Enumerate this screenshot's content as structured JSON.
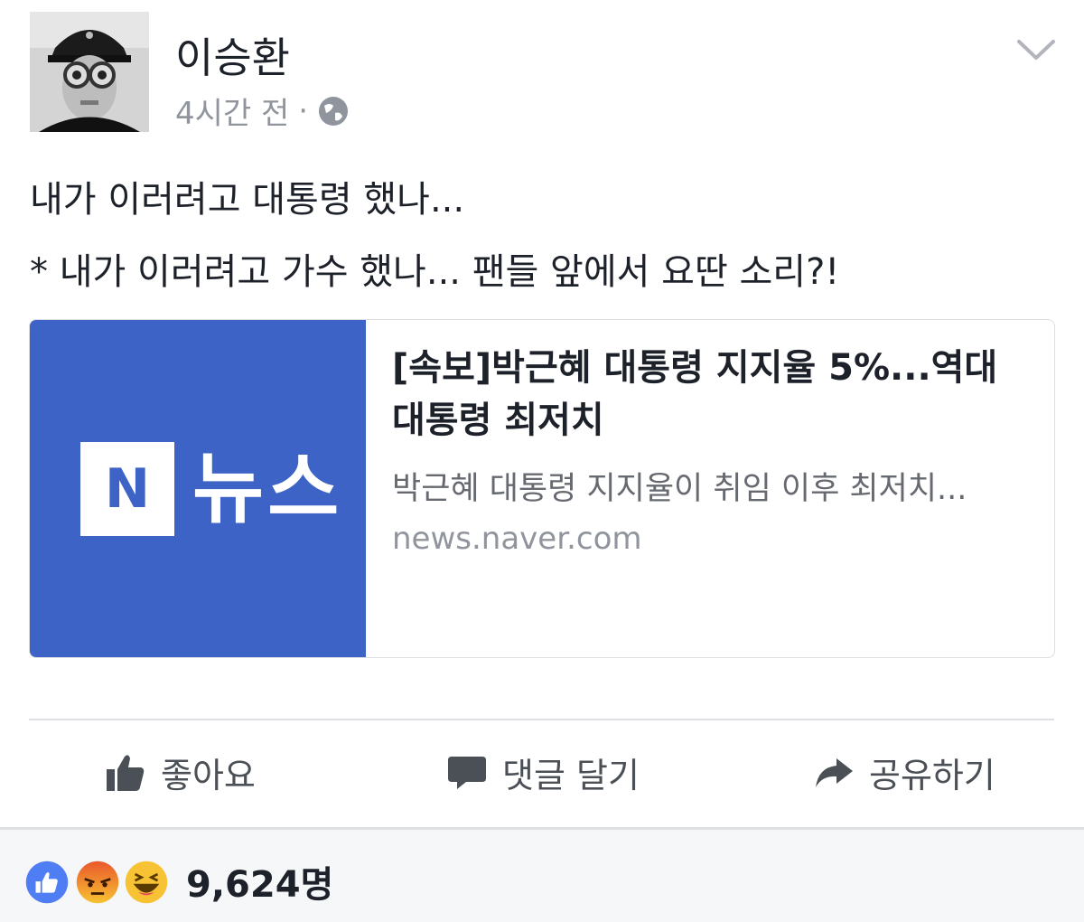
{
  "post": {
    "author": "이승환",
    "time": "4시간 전",
    "separator": "·",
    "privacy_icon": "globe-icon",
    "text_line1": "내가 이러려고 대통령 했나...",
    "text_line2": "* 내가 이러려고 가수 했나... 팬들 앞에서 요딴 소리?!"
  },
  "link_card": {
    "thumb_logo_letter": "N",
    "thumb_logo_word": "뉴스",
    "title": "[속보]박근혜 대통령 지지율 5%...역대 대통령 최저치",
    "description": "박근혜 대통령 지지율이 취임 이후 최저치...",
    "domain": "news.naver.com",
    "thumb_color": "#3d63c6"
  },
  "actions": {
    "like_label": "좋아요",
    "comment_label": "댓글 달기",
    "share_label": "공유하기"
  },
  "reactions": {
    "icons": [
      "like-reaction-icon",
      "angry-reaction-icon",
      "haha-reaction-icon"
    ],
    "count": "9,624명"
  },
  "colors": {
    "text_primary": "#1d2129",
    "text_secondary": "#90949c",
    "action_gray": "#4b4f56",
    "facebook_blue": "#4267b2"
  }
}
